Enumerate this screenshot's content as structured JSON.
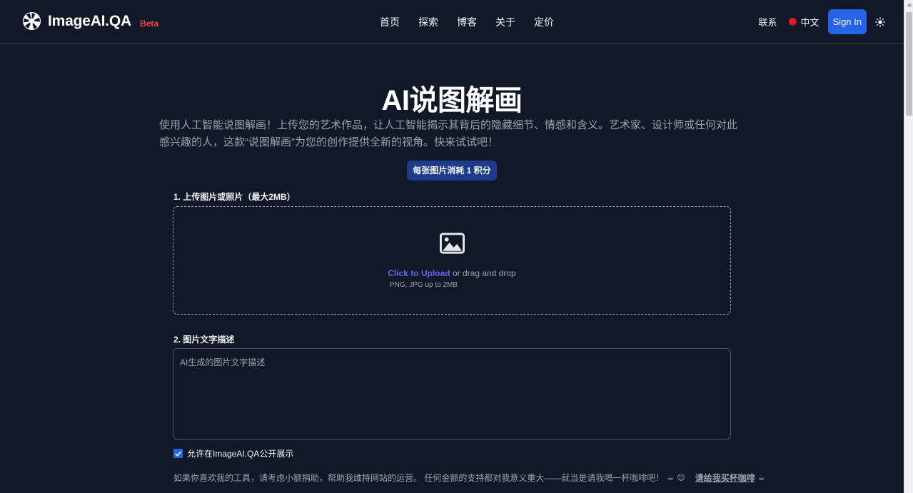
{
  "header": {
    "brand": "ImageAI.QA",
    "badge": "Beta",
    "nav": [
      "首页",
      "探索",
      "博客",
      "关于",
      "定价"
    ],
    "contact": "联系",
    "language": "中文",
    "signin_label": "Sign In"
  },
  "main": {
    "title": "AI说图解画",
    "subtitle": "使用人工智能说图解画！上传您的艺术作品，让人工智能揭示其背后的隐藏细节、情感和含义。艺术家、设计师或任何对此感兴趣的人，这款“说图解画”为您的创作提供全新的视角。快来试试吧！",
    "credit_note": "每张图片消耗 1 积分",
    "upload": {
      "label": "1. 上传图片或照片（最大2MB）",
      "link_text": "Click to Upload",
      "rest_text": " or drag and drop",
      "hint": "PNG, JPG up to 2MB"
    },
    "description": {
      "label": "2. 图片文字描述",
      "placeholder": "AI生成的图片文字描述",
      "value": ""
    },
    "public_checkbox": {
      "label": "允许在ImageAI.QA公开展示",
      "checked": true
    },
    "donate": {
      "text": "如果你喜欢我的工具，请考虑小额捐助，帮助我维持网站的运营。 任何金额的支持都对我意义重大——就当是请我喝一杯咖啡吧！",
      "link": "请给我买杯咖啡"
    }
  },
  "colors": {
    "background": "#111827",
    "primary": "#2563eb",
    "badge_bg": "#1e3a8a",
    "beta": "#ef4444",
    "link": "#6366f1"
  },
  "icons": [
    "logo-icon",
    "flag-icon",
    "sun-icon",
    "image-icon",
    "coffee-icon",
    "smile-icon"
  ]
}
